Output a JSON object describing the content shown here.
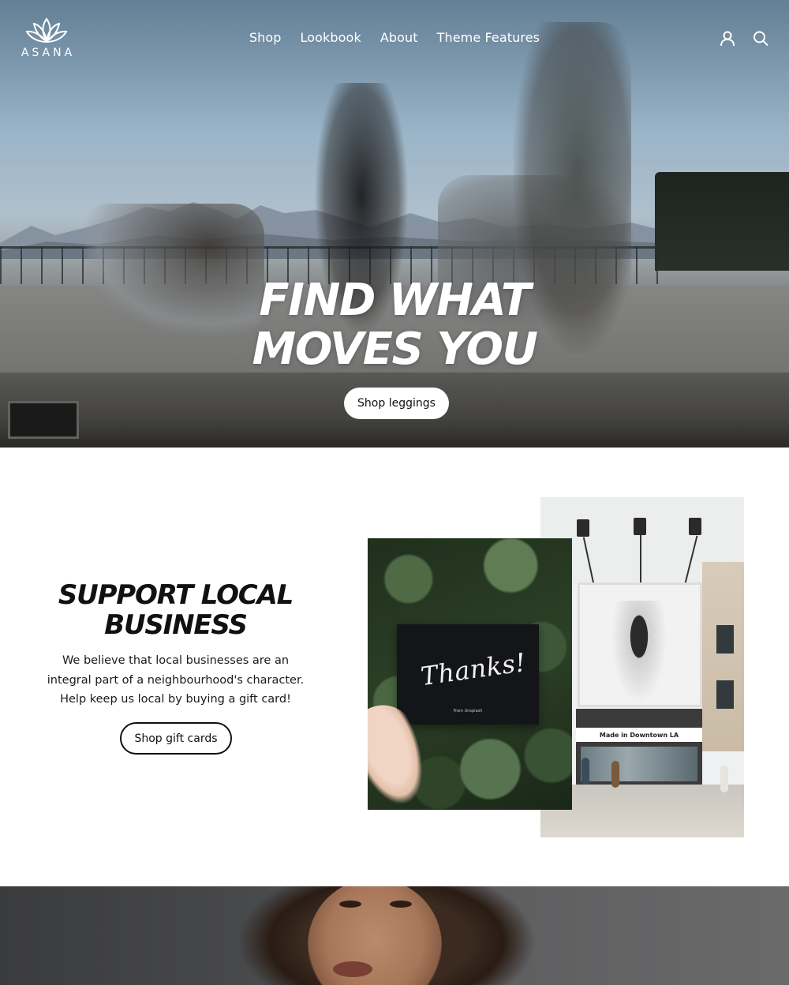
{
  "header": {
    "logo_text": "ASANA",
    "nav": [
      "Shop",
      "Lookbook",
      "About",
      "Theme Features"
    ],
    "icons": [
      "account-icon",
      "search-icon"
    ]
  },
  "hero": {
    "title_line1": "FIND WHAT",
    "title_line2": "MOVES YOU",
    "button_label": "Shop leggings"
  },
  "support": {
    "title_line1": "SUPPORT LOCAL",
    "title_line2": "BUSINESS",
    "text": "We believe that local businesses are an integral part of a neighbourhood's character. Help keep us local by buying a gift card!",
    "button_label": "Shop gift cards",
    "thanks_card_text": "Thanks!",
    "thanks_card_small": "From Unsplash",
    "billboard_sign": "Made in Downtown LA"
  },
  "colors": {
    "text": "#111111",
    "background": "#ffffff",
    "hero_text": "#ffffff"
  }
}
